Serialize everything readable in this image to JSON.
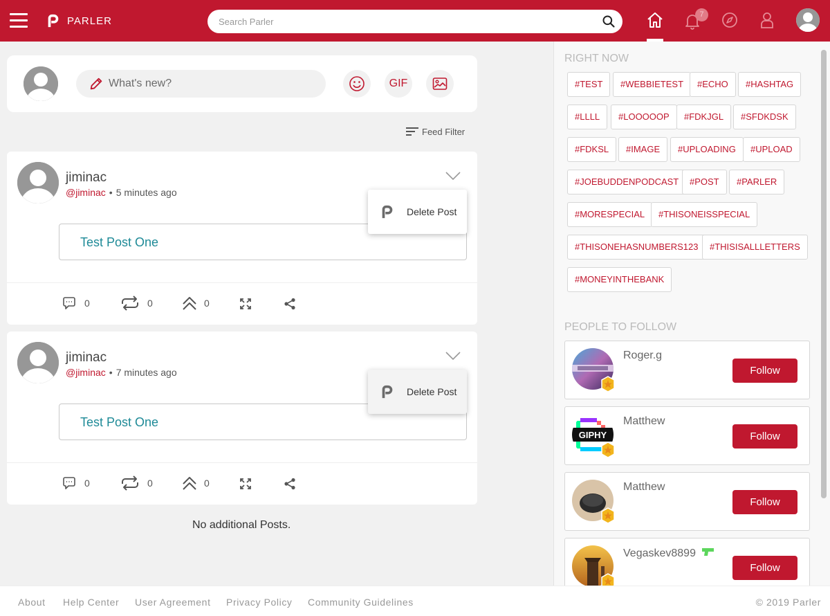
{
  "header": {
    "brand": "PARLER",
    "search_placeholder": "Search Parler",
    "notification_count": "7"
  },
  "composer": {
    "placeholder": "What's new?",
    "gif_label": "GIF"
  },
  "feed_filter_label": "Feed Filter",
  "posts": [
    {
      "name": "jiminac",
      "handle": "@jiminac",
      "separator": "•",
      "time": "5 minutes ago",
      "body": "Test Post One",
      "comments": "0",
      "echoes": "0",
      "upvotes": "0",
      "menu_item": "Delete Post"
    },
    {
      "name": "jiminac",
      "handle": "@jiminac",
      "separator": "•",
      "time": "7 minutes ago",
      "body": "Test Post One",
      "comments": "0",
      "echoes": "0",
      "upvotes": "0",
      "menu_item": "Delete Post"
    }
  ],
  "no_more_posts": "No additional Posts.",
  "sidebar": {
    "right_now_title": "RIGHT NOW",
    "hashtags": [
      "#TEST",
      "#WEBBIETEST",
      "#ECHO",
      "#HASHTAG",
      "#LLLL",
      "#LOOOOOP",
      "#FDKJGL",
      "#SFDKDSK",
      "#FDKSL",
      "#IMAGE",
      "#UPLOADING",
      "#UPLOAD",
      "#JOEBUDDENPODCAST",
      "#POST",
      "#PARLER",
      "#MORESPECIAL",
      "#THISONEISSPECIAL",
      "#THISONEHASNUMBERS123",
      "#THISISALLLETTERS",
      "#MONEYINTHEBANK"
    ],
    "people_title": "PEOPLE TO FOLLOW",
    "people": [
      {
        "name": "Roger.g",
        "follow_label": "Follow"
      },
      {
        "name": "Matthew",
        "follow_label": "Follow",
        "avatar_text": "GIPHY"
      },
      {
        "name": "Matthew",
        "follow_label": "Follow"
      },
      {
        "name": "Vegaskev8899",
        "follow_label": "Follow"
      }
    ]
  },
  "footer": {
    "links": [
      "About",
      "Help Center",
      "User Agreement",
      "Privacy Policy",
      "Community Guidelines"
    ],
    "copyright": "© 2019 Parler"
  },
  "colors": {
    "brand_red": "#c0182f",
    "post_text_teal": "#1e8a97"
  }
}
